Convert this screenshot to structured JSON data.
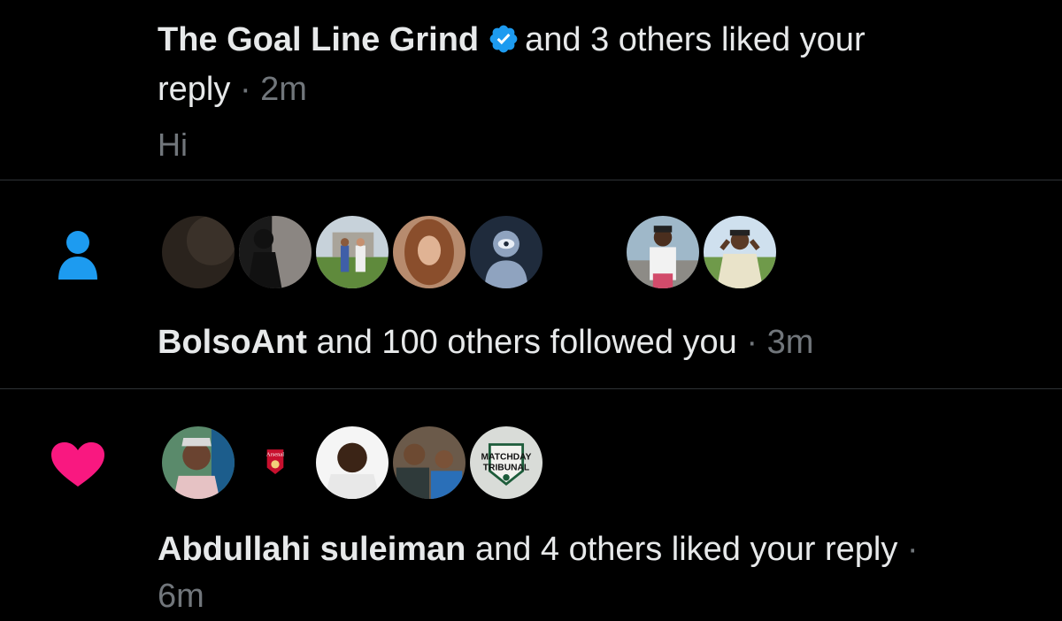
{
  "notifications": [
    {
      "type": "like",
      "actor": "The Goal Line Grind",
      "verified": true,
      "text": "and 3 others liked your",
      "text2": "reply",
      "time": "2m",
      "snippet": "Hi"
    },
    {
      "type": "follow",
      "actor": "BolsoAnt",
      "text": "and 100 others followed you",
      "time": "3m",
      "icon": "person-icon",
      "icon_color": "#1d9bf0"
    },
    {
      "type": "like",
      "actor": "Abdullahi suleiman",
      "text": "and 4 others liked your reply",
      "time": "6m",
      "icon": "heart-icon",
      "icon_color": "#f91880",
      "avatar_badges": {
        "arsenal": "Arsenal",
        "matchday_line1": "MATCHDAY",
        "matchday_line2": "TRIBUNAL"
      }
    }
  ],
  "separator": "·",
  "colors": {
    "background": "#000000",
    "text": "#e7e9ea",
    "muted": "#71767b",
    "divider": "#2f3336",
    "verified": "#1d9bf0"
  }
}
